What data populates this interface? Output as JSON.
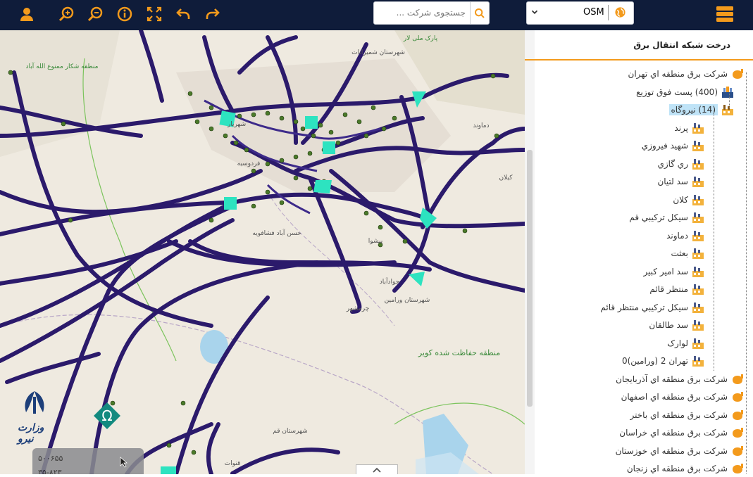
{
  "toolbar": {
    "search_placeholder": "جستجوی شرکت ...",
    "map_source": "OSM",
    "icons": [
      "user-icon",
      "zoom-in-icon",
      "zoom-out-icon",
      "info-icon",
      "fullscreen-icon",
      "undo-icon",
      "redo-icon",
      "search-icon",
      "globe-icon",
      "menu-icon"
    ]
  },
  "panel": {
    "title": "درخت شبکه انتقال برق",
    "tree": [
      {
        "label": "شرکت برق منطقه اي تهران",
        "type": "company"
      },
      {
        "label": "(400) پست فوق توزيع",
        "type": "substation"
      },
      {
        "label": "(14) نيروگاه",
        "type": "plants",
        "selected": true
      },
      {
        "label": "پرند",
        "type": "plant"
      },
      {
        "label": "شهيد فيروزي",
        "type": "plant"
      },
      {
        "label": "ري گازي",
        "type": "plant"
      },
      {
        "label": "سد لتيان",
        "type": "plant"
      },
      {
        "label": "کلان",
        "type": "plant"
      },
      {
        "label": "سيکل ترکيبي قم",
        "type": "plant"
      },
      {
        "label": "دماوند",
        "type": "plant"
      },
      {
        "label": "بعثت",
        "type": "plant"
      },
      {
        "label": "سد امير کبير",
        "type": "plant"
      },
      {
        "label": "منتظر قائم",
        "type": "plant"
      },
      {
        "label": "سيکل ترکيبي منتظر قائم",
        "type": "plant"
      },
      {
        "label": "سد طالقان",
        "type": "plant"
      },
      {
        "label": "لوارک",
        "type": "plant"
      },
      {
        "label": "تهران 2 (ورامين)0",
        "type": "plant"
      },
      {
        "label": "شرکت برق منطقه اي آذربايجان",
        "type": "company"
      },
      {
        "label": "شرکت برق منطقه اي اصفهان",
        "type": "company"
      },
      {
        "label": "شرکت برق منطقه اي باختر",
        "type": "company"
      },
      {
        "label": "شرکت برق منطقه اي خراسان",
        "type": "company"
      },
      {
        "label": "شرکت برق منطقه اي خوزستان",
        "type": "company"
      },
      {
        "label": "شرکت برق منطقه اي زنجان",
        "type": "company"
      }
    ]
  },
  "map": {
    "labels": {
      "shahriar": "شهریار",
      "ferdowsieh": "فردوسیه",
      "hasanabad": "حسن آباد فشافویه",
      "javadabad": "جوادآباد",
      "varamin": "شهرستان ورامین",
      "kavir": "منطقه حفاظت شده کویر",
      "qom": "شهرستان قم",
      "pishva": "پیشوا",
      "qanavat": "قنوات",
      "jarghoyeh": "چرمشهر",
      "damavand": "دماوند",
      "kilan": "کیلان",
      "park": "پارک ملی لار",
      "shemiranat": "شهرستان شمیرانات",
      "hoshdar": "منطقه شکار ممنوع الله آباد"
    },
    "colors": {
      "lines": "#2b1a6b",
      "nodes": "#4b7a2a",
      "subs": "#2de3c0",
      "accent": "#f39a1c"
    }
  },
  "overlay": {
    "ministry_logo_text": "وزارت نیرو",
    "card_line1": "۵۰۰۶۵۵",
    "card_line2": "۳۵-۸۲۳"
  }
}
